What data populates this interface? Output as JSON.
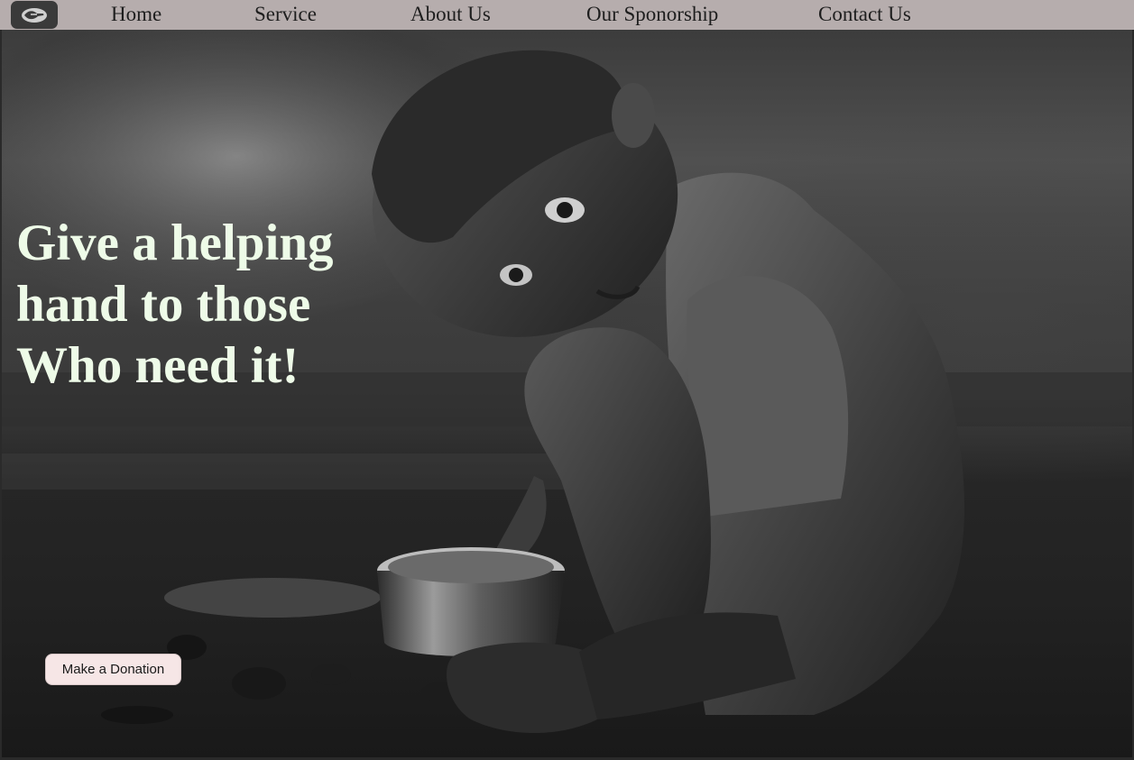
{
  "nav": {
    "logo_icon": "handshake-logo-icon",
    "items": [
      {
        "label": "Home"
      },
      {
        "label": "Service"
      },
      {
        "label": "About Us"
      },
      {
        "label": "Our Sponorship"
      },
      {
        "label": "Contact Us"
      }
    ]
  },
  "hero": {
    "headline_lines": [
      "Give a helping",
      "hand to those",
      "Who need it!"
    ],
    "cta_label": "Make a Donation",
    "headline_color": "#eefbe8"
  },
  "colors": {
    "navbar_bg": "#b6adad",
    "button_bg": "#f6e6e6"
  }
}
